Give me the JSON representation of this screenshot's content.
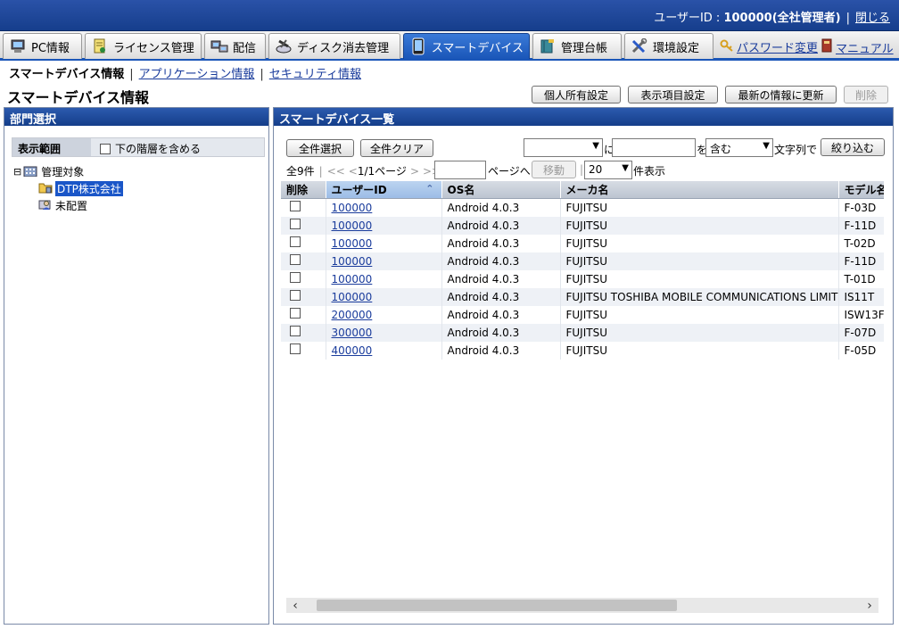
{
  "header": {
    "user_text": "ユーザーID : ",
    "user_id": "100000(全社管理者)",
    "separator": "|",
    "logout": "閉じる"
  },
  "tabs": [
    {
      "label": "PC情報",
      "icon": "pc-icon"
    },
    {
      "label": "ライセンス管理",
      "icon": "license-icon"
    },
    {
      "label": "配信",
      "icon": "delivery-icon"
    },
    {
      "label": "ディスク消去管理",
      "icon": "disk-erase-icon"
    },
    {
      "label": "スマートデバイス",
      "icon": "smartphone-icon",
      "active": true
    },
    {
      "label": "管理台帳",
      "icon": "ledger-icon"
    },
    {
      "label": "環境設定",
      "icon": "tools-icon"
    }
  ],
  "links": {
    "password_change": "パスワード変更",
    "manual": "マニュアル"
  },
  "subnav": {
    "current": "スマートデバイス情報",
    "app_info": "アプリケーション情報",
    "security_info": "セキュリティ情報"
  },
  "page": {
    "title": "スマートデバイス情報",
    "btn_personal": "個人所有設定",
    "btn_display": "表示項目設定",
    "btn_refresh": "最新の情報に更新",
    "btn_delete": "削除"
  },
  "left_panel": {
    "title": "部門選択",
    "scope_label": "表示範囲",
    "include_sub": "下の階層を含める",
    "tree_root": "管理対象",
    "tree_selected": "DTP株式会社",
    "tree_unassigned": "未配置",
    "tree_toggle": "⊟"
  },
  "right_panel": {
    "title": "スマートデバイス一覧",
    "select_all": "全件選択",
    "clear_all": "全件クリア",
    "ni": "に",
    "wo": "を",
    "condition_value": "含む",
    "text_label": "文字列で",
    "filter_btn": "絞り込む",
    "total": "全9件",
    "pager_first": "<<",
    "pager_prev": "<",
    "pager_pos": "1/1ページ",
    "pager_next": ">",
    "pager_last": ">>",
    "page_to": "ページへ",
    "move_btn": "移動",
    "per_page": "20",
    "per_page_label": "件表示"
  },
  "table": {
    "headers": [
      "削除",
      "ユーザーID",
      "OS名",
      "メーカ名",
      "モデル名"
    ],
    "rows": [
      {
        "user": "100000",
        "os": "Android 4.0.3",
        "maker": "FUJITSU",
        "model": "F-03D"
      },
      {
        "user": "100000",
        "os": "Android 4.0.3",
        "maker": "FUJITSU",
        "model": "F-11D"
      },
      {
        "user": "100000",
        "os": "Android 4.0.3",
        "maker": "FUJITSU",
        "model": "T-02D"
      },
      {
        "user": "100000",
        "os": "Android 4.0.3",
        "maker": "FUJITSU",
        "model": "F-11D"
      },
      {
        "user": "100000",
        "os": "Android 4.0.3",
        "maker": "FUJITSU",
        "model": "T-01D"
      },
      {
        "user": "100000",
        "os": "Android 4.0.3",
        "maker": "FUJITSU TOSHIBA MOBILE COMMUNICATIONS LIMITED",
        "model": "IS11T"
      },
      {
        "user": "200000",
        "os": "Android 4.0.3",
        "maker": "FUJITSU",
        "model": "ISW13F"
      },
      {
        "user": "300000",
        "os": "Android 4.0.3",
        "maker": "FUJITSU",
        "model": "F-07D"
      },
      {
        "user": "400000",
        "os": "Android 4.0.3",
        "maker": "FUJITSU",
        "model": "F-05D"
      }
    ]
  },
  "colors": {
    "header_blue": "#1a4a9c",
    "active_tab": "#1a56b8",
    "link": "#1a3c9c"
  }
}
